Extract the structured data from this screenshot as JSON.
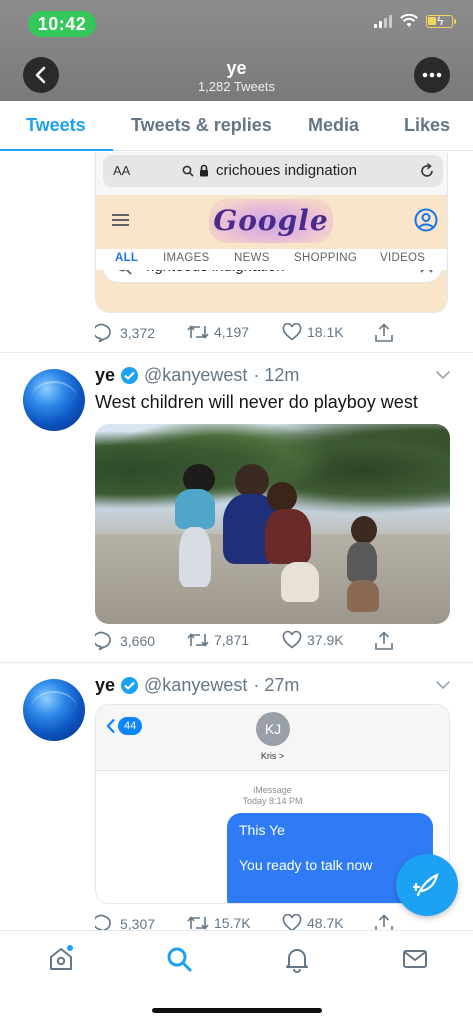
{
  "status_bar": {
    "time": "10:42"
  },
  "profile_header": {
    "name": "ye",
    "tweet_count": "1,282 Tweets"
  },
  "tabs": [
    {
      "label": "Tweets",
      "active": true
    },
    {
      "label": "Tweets & replies",
      "active": false
    },
    {
      "label": "Media",
      "active": false
    },
    {
      "label": "Likes",
      "active": false
    }
  ],
  "google_card": {
    "text_size_label": "AA",
    "url": "crichoues indignation",
    "search_query": "righteous indignation",
    "tabs": [
      "ALL",
      "IMAGES",
      "NEWS",
      "SHOPPING",
      "VIDEOS"
    ],
    "doodle_text": "Google"
  },
  "tweet0_actions": {
    "replies": "3,372",
    "retweets": "4,197",
    "likes": "18.1K"
  },
  "tweet1": {
    "name": "ye",
    "handle": "@kanyewest",
    "time": "· 12m",
    "text": "West children will never do playboy  west",
    "actions": {
      "replies": "3,660",
      "retweets": "7,871",
      "likes": "37.9K"
    }
  },
  "tweet2": {
    "name": "ye",
    "handle": "@kanyewest",
    "time": "· 27m",
    "actions": {
      "replies": "5,307",
      "retweets": "15.7K",
      "likes": "48.7K"
    },
    "imessage": {
      "back_badge": "44",
      "contact_initials": "KJ",
      "contact_name": "Kris >",
      "service_label": "iMessage",
      "timestamp": "Today 8:14 PM",
      "message_line1": "This Ye",
      "message_line2": "You ready to talk now"
    }
  },
  "colors": {
    "accent": "#1da1f2",
    "verified": "#1da1f2",
    "time_pill": "#34c759"
  }
}
